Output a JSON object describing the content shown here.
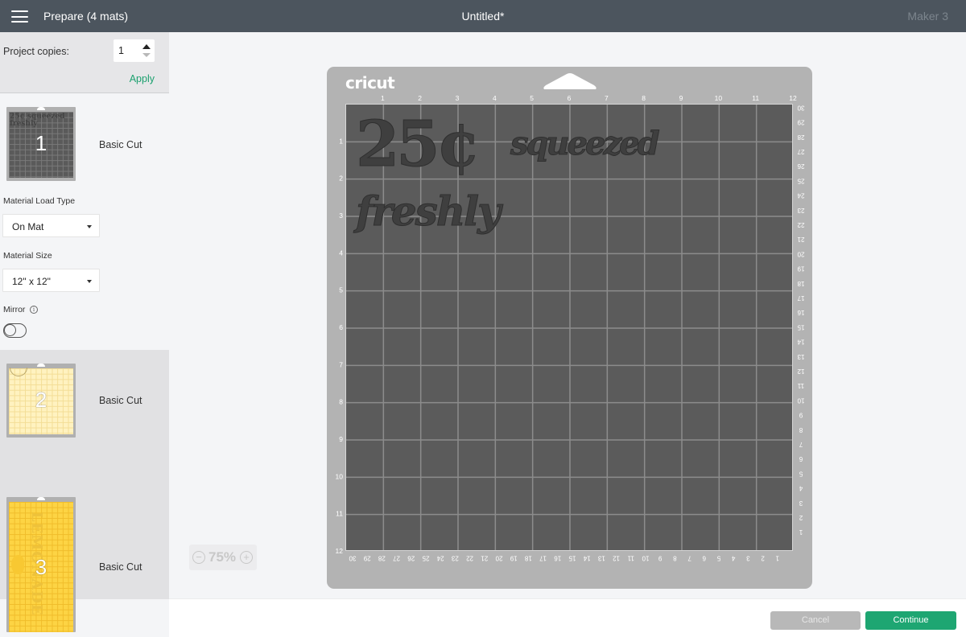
{
  "header": {
    "menu_icon": "hamburger-icon",
    "title_left": "Prepare (4 mats)",
    "project_name": "Untitled*",
    "machine": "Maker 3"
  },
  "sidebar": {
    "project_copies": {
      "label": "Project copies:",
      "value": "1",
      "apply_label": "Apply"
    },
    "mats": [
      {
        "number": "1",
        "label": "Basic Cut",
        "mat_color": "#5a5a5a",
        "preview_text": [
          "25¢ squeezed",
          "freshly"
        ],
        "selected": true
      },
      {
        "number": "2",
        "label": "Basic Cut",
        "mat_color": "#fff2c0"
      },
      {
        "number": "3",
        "label": "Basic Cut",
        "mat_color": "#fdd444",
        "preview_text": [
          "LEMONADE"
        ]
      }
    ],
    "material_load_type": {
      "label": "Material Load Type",
      "value": "On Mat"
    },
    "material_size": {
      "label": "Material Size",
      "value": "12\" x 12\""
    },
    "mirror": {
      "label": "Mirror",
      "info_icon": "info-icon",
      "enabled": false
    }
  },
  "canvas": {
    "mat_brand": "cricut",
    "mat_color": "#5b5b5b",
    "ruler_top": [
      "1",
      "2",
      "3",
      "4",
      "5",
      "6",
      "7",
      "8",
      "9",
      "10",
      "11",
      "12"
    ],
    "ruler_left": [
      "1",
      "2",
      "3",
      "4",
      "5",
      "6",
      "7",
      "8",
      "9",
      "10",
      "11",
      "12"
    ],
    "ruler_right_cm": [
      "30",
      "29",
      "28",
      "27",
      "26",
      "25",
      "24",
      "23",
      "22",
      "21",
      "20",
      "19",
      "18",
      "17",
      "16",
      "15",
      "14",
      "13",
      "12",
      "11",
      "10",
      "9",
      "8",
      "7",
      "6",
      "5",
      "4",
      "3",
      "2",
      "1"
    ],
    "ruler_bottom_cm": [
      "30",
      "29",
      "28",
      "27",
      "26",
      "25",
      "24",
      "23",
      "22",
      "21",
      "20",
      "19",
      "18",
      "17",
      "16",
      "15",
      "14",
      "13",
      "12",
      "11",
      "10",
      "9",
      "8",
      "7",
      "6",
      "5",
      "4",
      "3",
      "2",
      "1"
    ],
    "design_text": {
      "line1_big": "25¢",
      "line1_word": "squeezed",
      "line2": "freshly",
      "fill": "#3f3f3f"
    },
    "zoom": {
      "value": "75%",
      "minus_icon": "zoom-out-icon",
      "plus_icon": "zoom-in-icon"
    }
  },
  "footer": {
    "cancel_label": "Cancel",
    "continue_label": "Continue",
    "accent": "#1ea672"
  }
}
